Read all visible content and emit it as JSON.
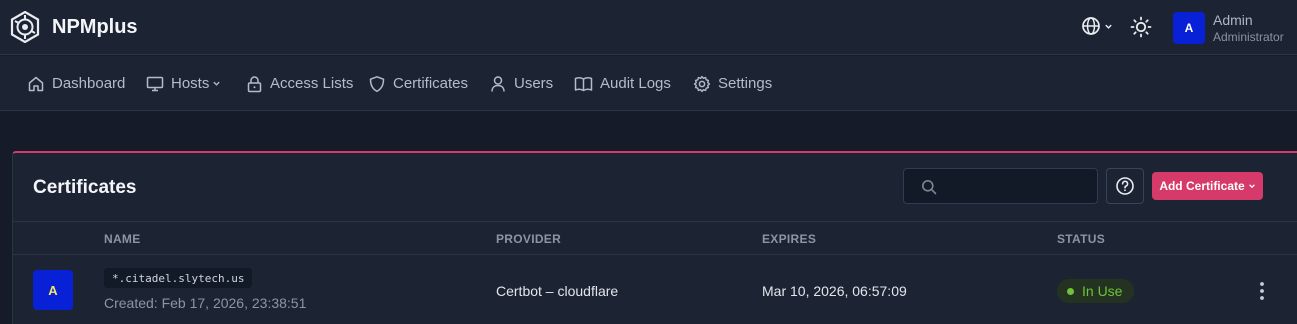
{
  "app": {
    "name": "NPMplus"
  },
  "user": {
    "initial": "A",
    "name": "Admin",
    "role": "Administrator"
  },
  "nav": [
    {
      "label": "Dashboard",
      "icon": "home-icon"
    },
    {
      "label": "Hosts",
      "icon": "monitor-icon",
      "dropdown": true
    },
    {
      "label": "Access Lists",
      "icon": "lock-icon"
    },
    {
      "label": "Certificates",
      "icon": "shield-icon"
    },
    {
      "label": "Users",
      "icon": "user-icon"
    },
    {
      "label": "Audit Logs",
      "icon": "book-icon"
    },
    {
      "label": "Settings",
      "icon": "gear-icon"
    }
  ],
  "card": {
    "title": "Certificates",
    "search_placeholder": "",
    "add_label": "Add Certificate"
  },
  "table": {
    "columns": [
      "Name",
      "Provider",
      "Expires",
      "Status"
    ],
    "rows": [
      {
        "avatar": "A",
        "domain": "*.citadel.slytech.us",
        "created": "Created: Feb 17, 2026, 23:38:51",
        "provider": "Certbot – cloudflare",
        "expires": "Mar 10, 2026, 06:57:09",
        "status": "In Use"
      }
    ]
  },
  "colors": {
    "accent": "#d63a6a",
    "avatar_bg": "#0921d6",
    "status_green": "#6fc23a"
  }
}
